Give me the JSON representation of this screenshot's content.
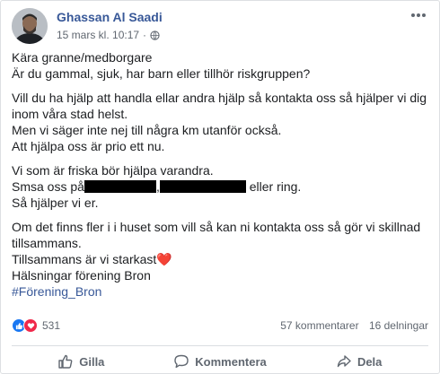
{
  "post": {
    "author": "Ghassan Al Saadi",
    "timestamp": "15 mars kl. 10:17",
    "separator": "·",
    "paragraphs": [
      [
        "Kära granne/medborgare",
        "Är du gammal, sjuk, har barn eller tillhör riskgruppen?"
      ],
      [
        "Vill du ha hjälp att handla ellar andra hjälp så kontakta oss så hjälper vi dig",
        "inom våra stad helst.",
        "Men vi säger inte nej till några km utanför också.",
        "Att hjälpa oss är prio ett nu."
      ],
      [
        "Vi som är friska bör hjälpa varandra."
      ]
    ],
    "sms_line": {
      "prefix": "Smsa oss på",
      "between": ",",
      "suffix": "eller ring."
    },
    "after_sms": "Så hjälper vi er.",
    "paragraph4": [
      "Om det finns fler i i huset som vill så kan ni kontakta oss så gör vi skillnad",
      "tillsammans."
    ],
    "strongest": "Tillsammans är vi starkast",
    "heart": "❤️",
    "greeting": "Hälsningar förening Bron",
    "hashtag": "#Förening_Bron"
  },
  "stats": {
    "reaction_count": "531",
    "comments": "57 kommentarer",
    "shares": "16 delningar"
  },
  "actions": {
    "like": "Gilla",
    "comment": "Kommentera",
    "share": "Dela"
  },
  "colors": {
    "link": "#385898",
    "like_blue": "#1877f2",
    "love_red": "#f0284a"
  },
  "icons": {
    "menu": "more-horizontal-icon",
    "audience": "globe-icon",
    "like": "thumbs-up-icon",
    "comment": "comment-bubble-icon",
    "share": "share-arrow-icon"
  }
}
